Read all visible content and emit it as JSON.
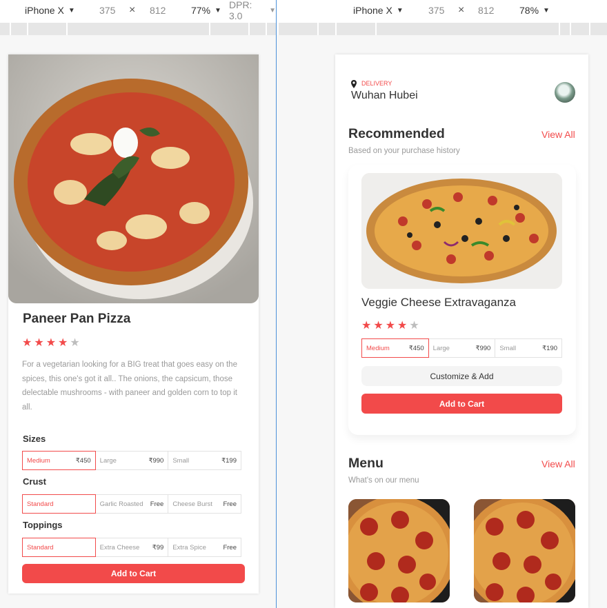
{
  "devtools": {
    "left": {
      "device": "iPhone X",
      "width": "375",
      "times": "×",
      "height": "812",
      "zoom": "77%",
      "dpr": "DPR: 3.0"
    },
    "right": {
      "device": "iPhone X",
      "width": "375",
      "times": "×",
      "height": "812",
      "zoom": "78%"
    }
  },
  "detail": {
    "title": "Paneer Pan Pizza",
    "rating": 4,
    "max_rating": 5,
    "description": "For a vegetarian looking for a BIG treat that goes easy on the spices, this one's got it all.. The onions, the capsicum, those delectable mushrooms - with paneer and golden corn to top it all.",
    "sections": [
      {
        "label": "Sizes",
        "options": [
          {
            "name": "Medium",
            "price": "₹450",
            "selected": true
          },
          {
            "name": "Large",
            "price": "₹990",
            "selected": false
          },
          {
            "name": "Small",
            "price": "₹199",
            "selected": false
          }
        ]
      },
      {
        "label": "Crust",
        "options": [
          {
            "name": "Standard",
            "price": "",
            "selected": true
          },
          {
            "name": "Garlic Roasted",
            "price": "Free",
            "selected": false
          },
          {
            "name": "Cheese Burst",
            "price": "Free",
            "selected": false
          }
        ]
      },
      {
        "label": "Toppings",
        "options": [
          {
            "name": "Standard",
            "price": "",
            "selected": true
          },
          {
            "name": "Extra Cheese",
            "price": "₹99",
            "selected": false
          },
          {
            "name": "Extra Spice",
            "price": "Free",
            "selected": false
          }
        ]
      }
    ],
    "add_to_cart": "Add to Cart"
  },
  "home": {
    "delivery_label": "DELIVERY",
    "location": "Wuhan Hubei",
    "recommended": {
      "title": "Recommended",
      "view_all": "View All",
      "subtitle": "Based on your purchase history"
    },
    "product": {
      "name": "Veggie Cheese Extravaganza",
      "rating": 4,
      "max_rating": 5,
      "sizes": [
        {
          "name": "Medium",
          "price": "₹450",
          "selected": true
        },
        {
          "name": "Large",
          "price": "₹990",
          "selected": false
        },
        {
          "name": "Small",
          "price": "₹190",
          "selected": false
        }
      ],
      "customize": "Customize & Add",
      "add_to_cart": "Add to Cart"
    },
    "menu": {
      "title": "Menu",
      "view_all": "View All",
      "subtitle": "What's on our menu"
    }
  },
  "colors": {
    "accent": "#f24a4a",
    "star_off": "#bdbdbd"
  }
}
